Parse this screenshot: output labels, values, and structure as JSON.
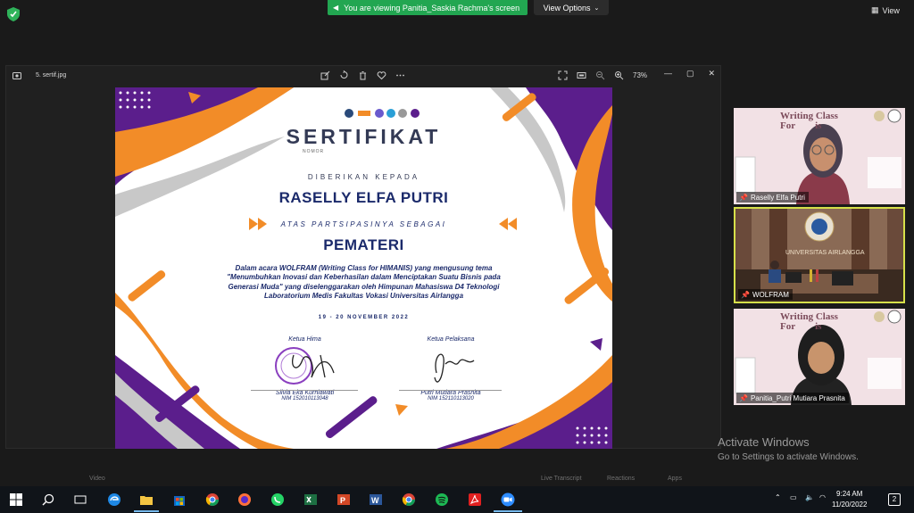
{
  "zoom": {
    "share_banner": "You are viewing Panitia_Saskia Rachma's screen",
    "view_options": "View Options",
    "view_button": "View",
    "controls": [
      "Video",
      "Live Transcript",
      "Reactions",
      "Apps"
    ]
  },
  "viewer": {
    "filename": "5. sertif.jpg",
    "zoom_level": "73%"
  },
  "certificate": {
    "title": "SERTIFIKAT",
    "nomor": "NOMOR",
    "given_to": "DIBERIKAN KEPADA",
    "recipient": "RASELLY ELFA PUTRI",
    "as_label": "ATAS PARTSIPASINYA SEBAGAI",
    "role": "PEMATERI",
    "description": "Dalam acara WOLFRAM (Writing Class for HIMANIS) yang mengusung tema \"Menumbuhkan Inovasi dan Keberhasilan dalam Menciptakan Suatu Bisnis pada Generasi Muda\" yang diselenggarakan oleh Himpunan Mahasiswa D4 Teknologi Laboratorium Medis Fakultas Vokasi Universitas Airlangga",
    "date": "19 - 20 NOVEMBER 2022",
    "signer_left": {
      "role": "Ketua Hima",
      "name": "Silvia Eka Kurniawati",
      "nim": "NIM 152010113048"
    },
    "signer_right": {
      "role": "Ketua Pelaksana",
      "name": "Putri Mutiara Prasnita",
      "nim": "NIM 152110113020"
    },
    "colors": {
      "purple": "#5b1e8c",
      "orange": "#f28c28",
      "gray": "#c8c8c8",
      "navy": "#1b2a6b"
    }
  },
  "participants": [
    {
      "name": "Raselly Elfa Putri",
      "bg_text": "Writing Class For...is",
      "active": false
    },
    {
      "name": "WOLFRAM",
      "bg_text": "UNIVERSITAS AIRLANGGA",
      "active": true
    },
    {
      "name": "Panitia_Putri Mutiara Prasnita",
      "bg_text": "Writing Class For...is",
      "active": false
    }
  ],
  "activate": {
    "title": "Activate Windows",
    "subtitle": "Go to Settings to activate Windows."
  },
  "taskbar": {
    "time": "9:24 AM",
    "date": "11/20/2022",
    "notifications": "2",
    "apps": [
      "start-icon",
      "search-icon",
      "task-view-icon",
      "edge-icon",
      "file-explorer-icon",
      "store-icon",
      "chrome-icon",
      "firefox-icon",
      "whatsapp-icon",
      "excel-icon",
      "powerpoint-icon",
      "word-icon",
      "chrome-icon",
      "spotify-icon",
      "acrobat-icon",
      "zoom-icon"
    ]
  }
}
